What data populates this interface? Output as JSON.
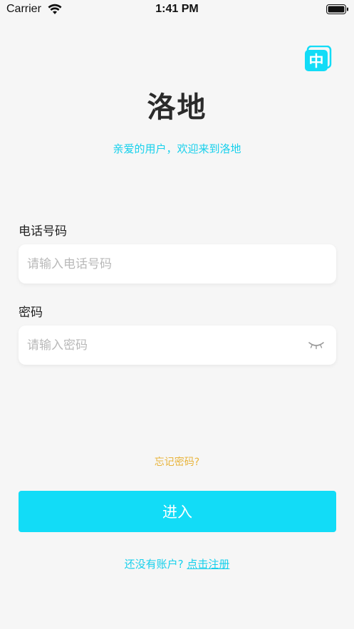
{
  "status_bar": {
    "carrier": "Carrier",
    "time": "1:41 PM"
  },
  "header": {
    "language_icon_text": "中",
    "title": "洛地",
    "subtitle": "亲爱的用户，欢迎来到洛地"
  },
  "form": {
    "phone": {
      "label": "电话号码",
      "placeholder": "请输入电话号码",
      "value": ""
    },
    "password": {
      "label": "密码",
      "placeholder": "请输入密码",
      "value": "",
      "toggle_icon": "eye-closed-icon"
    }
  },
  "forgot_password": "忘记密码?",
  "submit_label": "进入",
  "signup": {
    "prompt": "还没有账户?",
    "link": "点击注册"
  },
  "colors": {
    "accent": "#12dcf7",
    "link": "#16d0ec",
    "forgot": "#e8b43c",
    "background": "#f6f6f6"
  }
}
